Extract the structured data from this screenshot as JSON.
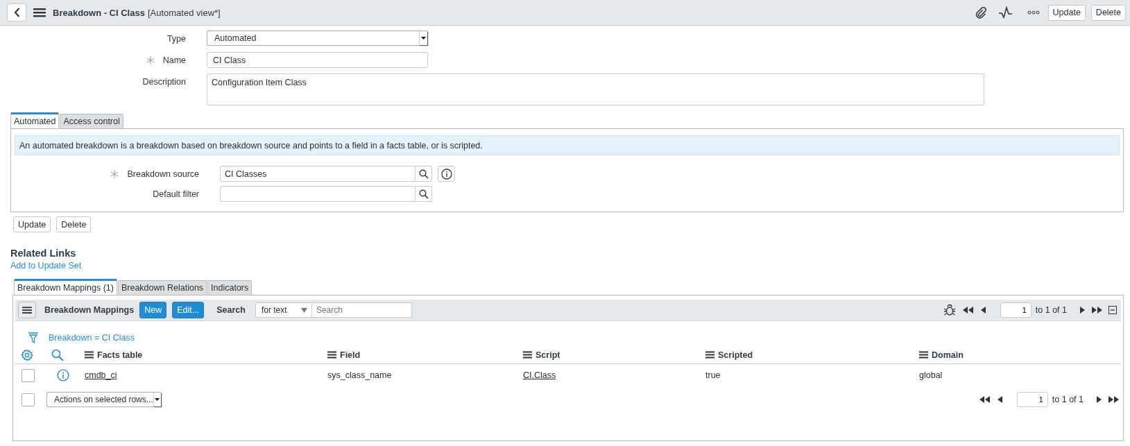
{
  "header": {
    "title": "Breakdown - CI Class",
    "view": "[Automated view*]",
    "buttons": [
      "Update",
      "Delete"
    ]
  },
  "form": {
    "fields": [
      {
        "kind": "select",
        "label": "Type",
        "value": "Automated",
        "required": false
      },
      {
        "kind": "text",
        "label": "Name",
        "value": "CI Class",
        "required": true
      },
      {
        "kind": "textarea",
        "label": "Description",
        "value": "Configuration Item Class",
        "required": false
      }
    ]
  },
  "section_tabs": [
    {
      "label": "Automated",
      "selected": true
    },
    {
      "label": "Access control",
      "selected": false
    }
  ],
  "section": {
    "info": "An automated breakdown is a breakdown based on breakdown source and points to a field in a facts table, or is scripted.",
    "fields": [
      {
        "kind": "reference",
        "label": "Breakdown source",
        "value": "CI Classes",
        "required": true,
        "info_button": true
      },
      {
        "kind": "reference",
        "label": "Default filter",
        "required": false,
        "info_button": false
      }
    ]
  },
  "form_buttons": [
    "Update",
    "Delete"
  ],
  "related_links": {
    "title": "Related Links",
    "links": [
      "Add to Update Set"
    ]
  },
  "related_tabs": [
    {
      "label": "Breakdown Mappings (1)",
      "selected": true
    },
    {
      "label": "Breakdown Relations",
      "selected": false
    },
    {
      "label": "Indicators",
      "selected": false
    }
  ],
  "related_list": {
    "title": "Breakdown Mappings",
    "buttons": [
      "New",
      "Edit..."
    ],
    "search_label": "Search",
    "search_scope": "for text",
    "search_placeholder": "Search",
    "page": "1",
    "range": "to 1 of 1",
    "filter": "Breakdown = CI Class",
    "columns": [
      "Facts table",
      "Field",
      "Script",
      "Scripted",
      "Domain"
    ],
    "rows": [
      {
        "checked": false,
        "cells": [
          {
            "kind": "link",
            "text": "cmdb_ci"
          },
          {
            "kind": "text",
            "text": "sys_class_name"
          },
          {
            "kind": "link",
            "text": "CI.Class"
          },
          {
            "kind": "text",
            "text": "true"
          },
          {
            "kind": "text",
            "text": "global"
          }
        ]
      }
    ],
    "select_all": {
      "checked": false
    },
    "actions": "Actions on selected rows...",
    "bottom_page": "1",
    "bottom_range": "to 1 of 1"
  }
}
